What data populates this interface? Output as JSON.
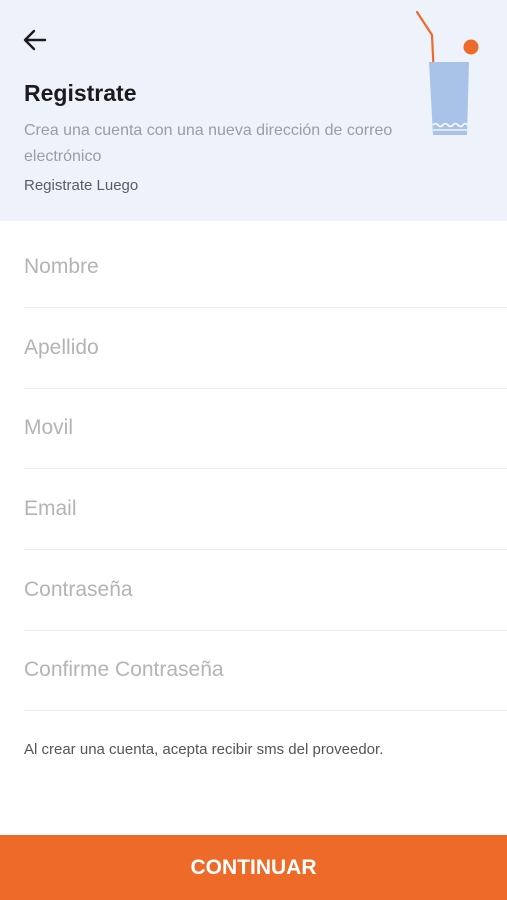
{
  "header": {
    "title": "Registrate",
    "subtitle": "Crea una cuenta con una nueva dirección de correo electrónico",
    "later_link": "Registrate Luego",
    "back_icon": "arrow-left-icon",
    "illustration_icon": "drink-glass-icon"
  },
  "form": {
    "fields": [
      {
        "placeholder": "Nombre",
        "value": ""
      },
      {
        "placeholder": "Apellido",
        "value": ""
      },
      {
        "placeholder": "Movil",
        "value": ""
      },
      {
        "placeholder": "Email",
        "value": ""
      },
      {
        "placeholder": "Contraseña",
        "value": ""
      },
      {
        "placeholder": "Confirme Contraseña",
        "value": ""
      }
    ],
    "disclaimer": "Al crear una cuenta, acepta recibir sms del proveedor."
  },
  "footer": {
    "continue_label": "CONTINUAR"
  },
  "colors": {
    "accent": "#ee6a28",
    "header_bg": "#eef2fa",
    "glass": "#a9c3e8"
  }
}
